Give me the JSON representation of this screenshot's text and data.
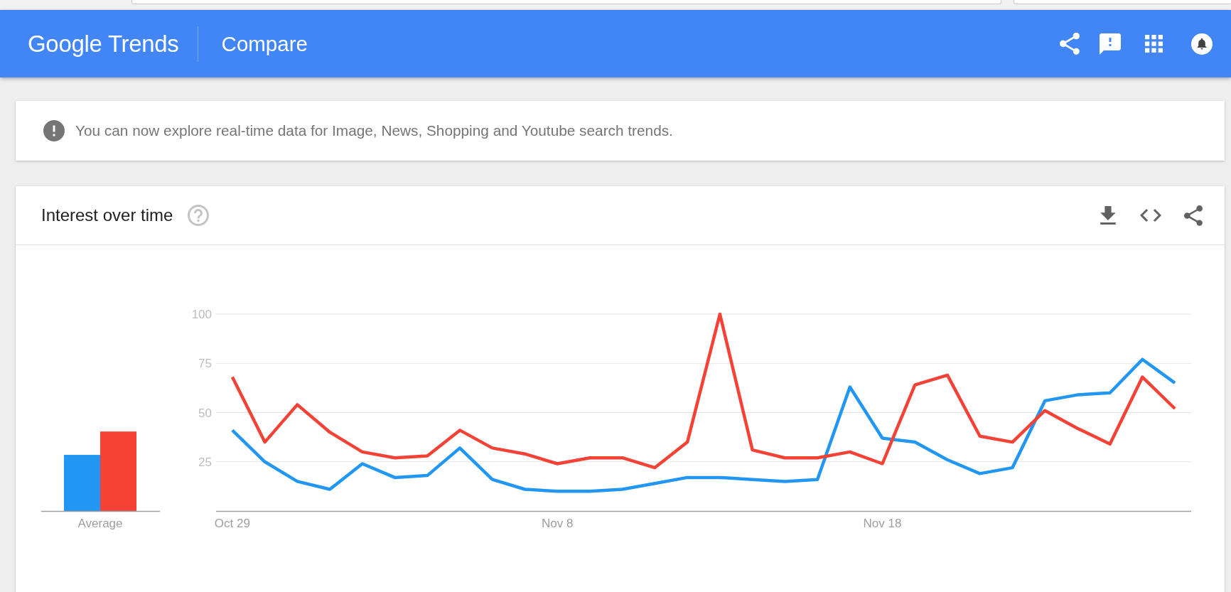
{
  "header": {
    "logo": "Google Trends",
    "title": "Compare"
  },
  "notice": {
    "text": "You can now explore real-time data for Image, News, Shopping and Youtube search trends."
  },
  "interest_over_time": {
    "title": "Interest over time",
    "average_label": "Average",
    "chart_data": {
      "type": "line",
      "categories": [
        "Oct 29",
        null,
        null,
        null,
        null,
        null,
        null,
        null,
        null,
        null,
        "Nov 8",
        null,
        null,
        null,
        null,
        null,
        null,
        null,
        null,
        null,
        "Nov 18",
        null,
        null,
        null,
        null,
        null,
        null,
        null,
        null,
        null
      ],
      "ylim": [
        0,
        100
      ],
      "yticks": [
        25,
        50,
        75,
        100
      ],
      "grid": true,
      "series": [
        {
          "color": "#2196f3",
          "values": [
            41,
            25,
            15,
            11,
            24,
            17,
            18,
            32,
            16,
            11,
            10,
            10,
            11,
            14,
            17,
            17,
            16,
            15,
            16,
            63,
            37,
            35,
            26,
            19,
            22,
            56,
            59,
            60,
            77,
            65
          ]
        },
        {
          "color": "#f44336",
          "values": [
            68,
            35,
            54,
            40,
            30,
            27,
            28,
            41,
            32,
            29,
            24,
            27,
            27,
            22,
            35,
            100,
            31,
            27,
            27,
            30,
            24,
            64,
            69,
            38,
            35,
            51,
            42,
            34,
            68,
            52
          ]
        }
      ]
    }
  }
}
